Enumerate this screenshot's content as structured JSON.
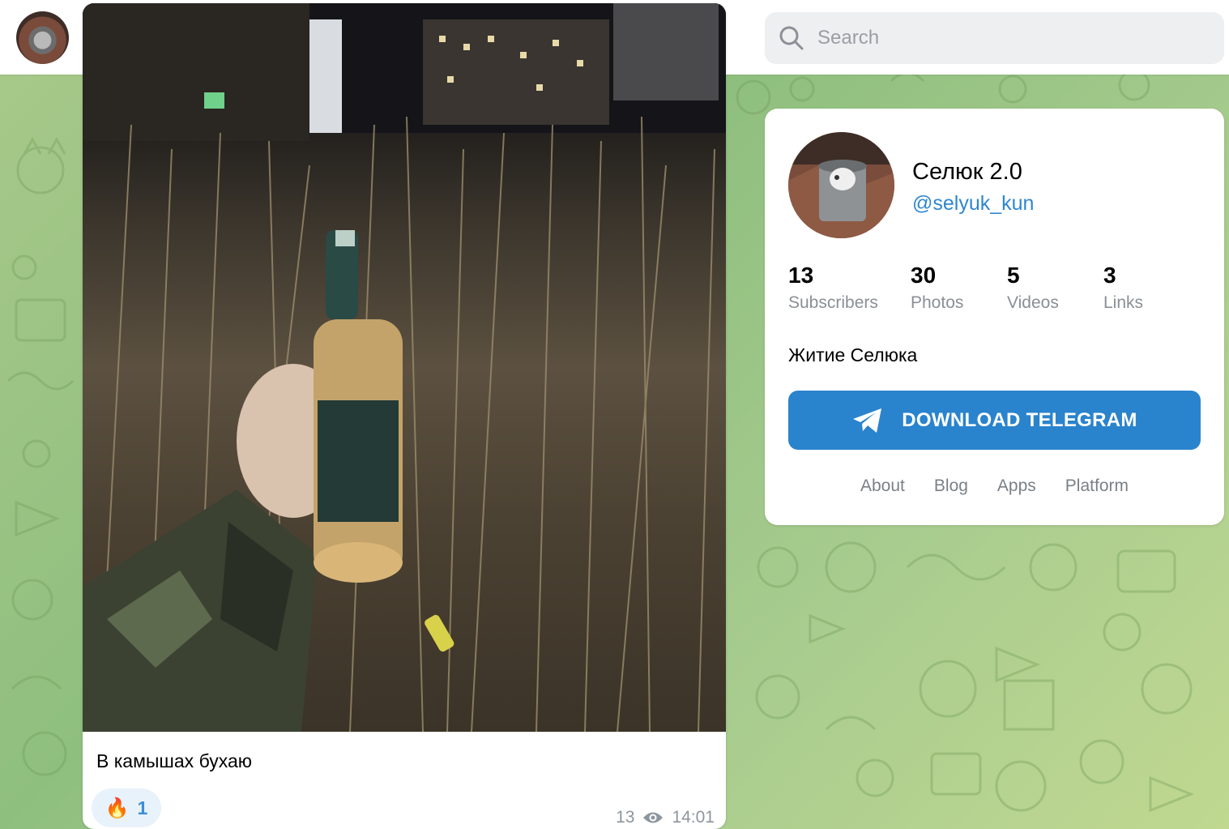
{
  "header": {
    "avatar_alt": "channel avatar",
    "search_placeholder": "Search"
  },
  "post": {
    "caption": "В камышах бухаю",
    "reaction": {
      "emoji": "🔥",
      "count": "1"
    },
    "views": "13",
    "time": "14:01"
  },
  "channel": {
    "title": "Селюк 2.0",
    "handle": "@selyuk_kun",
    "stats": [
      {
        "value": "13",
        "label": "Subscribers"
      },
      {
        "value": "30",
        "label": "Photos"
      },
      {
        "value": "5",
        "label": "Videos"
      },
      {
        "value": "3",
        "label": "Links"
      }
    ],
    "description": "Житие Селюка",
    "download_label": "DOWNLOAD TELEGRAM",
    "footer_links": [
      "About",
      "Blog",
      "Apps",
      "Platform"
    ]
  },
  "colors": {
    "accent": "#2a83cd",
    "link": "#2e87cf",
    "reaction_bg": "#e8f2fb",
    "background": "#9fc785"
  }
}
